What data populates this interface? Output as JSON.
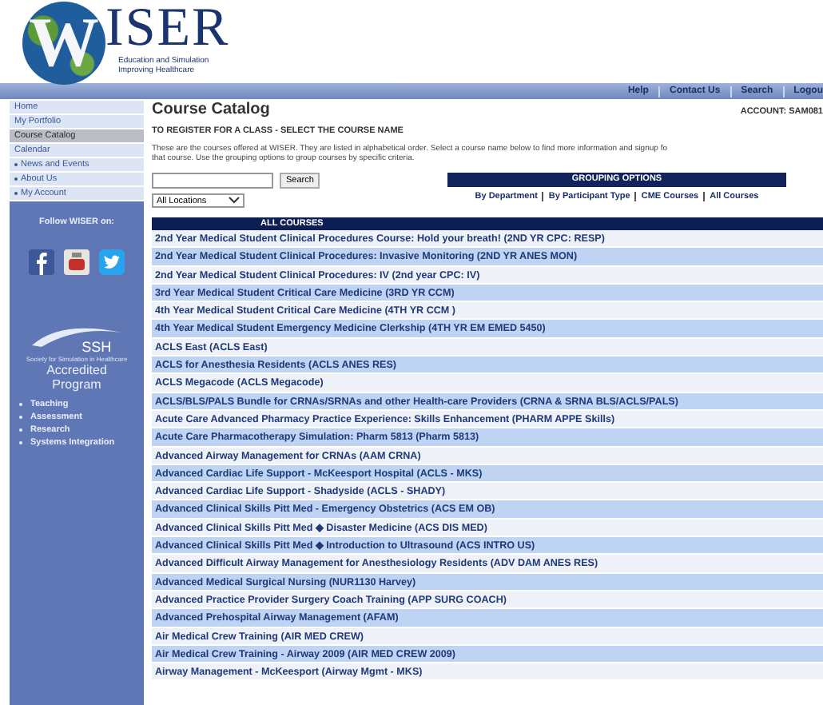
{
  "logo": {
    "initial": "W",
    "rest": "ISER",
    "tagline_1": "Education and Simulation",
    "tagline_2": "Improving Healthcare"
  },
  "top_nav": [
    "Help",
    "Contact Us",
    "Search",
    "Logou"
  ],
  "sidebar": {
    "items": [
      {
        "label": "Home",
        "selected": false,
        "bullet": false
      },
      {
        "label": "My Portfolio",
        "selected": false,
        "bullet": false
      },
      {
        "label": "Course Catalog",
        "selected": true,
        "bullet": false
      },
      {
        "label": "Calendar",
        "selected": false,
        "bullet": false
      },
      {
        "label": "News and Events",
        "selected": false,
        "bullet": true
      },
      {
        "label": "About Us",
        "selected": false,
        "bullet": true
      },
      {
        "label": "My Account",
        "selected": false,
        "bullet": true
      }
    ],
    "follow_label": "Follow WISER on:",
    "ssh": {
      "mark": "SSH",
      "caption": "Society for Simulation in Healthcare",
      "title_1": "Accredited",
      "title_2": "Program"
    },
    "accreditations": [
      "Teaching",
      "Assessment",
      "Research",
      "Systems Integration"
    ]
  },
  "page": {
    "title": "Course Catalog",
    "account": "ACCOUNT: SAM081",
    "subtitle": "TO REGISTER FOR A CLASS - SELECT THE COURSE NAME",
    "intro": "These are the courses offered at WISER. They are listed in alphabetical order. Select a course name below to find more information and signup fo\nthat course. Use the grouping options to group courses by specific criteria.",
    "search_button": "Search",
    "location": "All Locations",
    "grouping": {
      "title": "GROUPING OPTIONS",
      "links": [
        "By Department",
        "By Participant Type",
        "CME Courses",
        "All Courses"
      ]
    },
    "table": {
      "header": "ALL COURSES",
      "rows": [
        "2nd Year Medical Student Clinical Procedures Course: Hold your breath! (2ND YR CPC: RESP)",
        "2nd Year Medical Student Clinical Procedures: Invasive Monitoring (2ND YR ANES MON)",
        "2nd Year Medical Student Clinical Procedures: IV (2nd year CPC: IV)",
        "3rd Year Medical Student Critical Care Medicine (3RD YR CCM)",
        "4th Year Medical Student Critical Care Medicine (4TH YR CCM )",
        "4th Year Medical Student Emergency Medicine Clerkship (4TH YR EM EMED 5450)",
        "ACLS East (ACLS East)",
        "ACLS for Anesthesia Residents (ACLS ANES RES)",
        "ACLS Megacode (ACLS Megacode)",
        "ACLS/BLS/PALS Bundle for CRNAs/SRNAs and other Health-care Providers (CRNA & SRNA BLS/ACLS/PALS)",
        "Acute Care Advanced Pharmacy Practice Experience: Skills Enhancement (PHARM APPE Skills)",
        "Acute Care Pharmacotherapy Simulation: Pharm 5813 (Pharm 5813)",
        "Advanced Airway Management for CRNAs (AAM CRNA)",
        "Advanced Cardiac Life Support - McKeesport Hospital (ACLS - MKS)",
        "Advanced Cardiac Life Support - Shadyside (ACLS - SHADY)",
        "Advanced Clinical Skills Pitt Med - Emergency Obstetrics (ACS EM OB)",
        "Advanced Clinical Skills Pitt Med ◆ Disaster Medicine (ACS DIS MED)",
        "Advanced Clinical Skills Pitt Med ◆ Introduction to Ultrasound (ACS INTRO US)",
        "Advanced Difficult Airway Management for Anesthesiology Residents (ADV DAM ANES RES)",
        "Advanced Medical Surgical Nursing (NUR1130 Harvey)",
        "Advanced Practice Provider Surgery Coach Training (APP SURG COACH)",
        "Advanced Prehospital Airway Management (AFAM)",
        "Air Medical Crew Training (AIR MED CREW)",
        "Air Medical Crew Training - Airway 2009 (AIR MED CREW 2009)",
        "Airway Management - McKeesport (Airway Mgmt - MKS)"
      ]
    }
  }
}
